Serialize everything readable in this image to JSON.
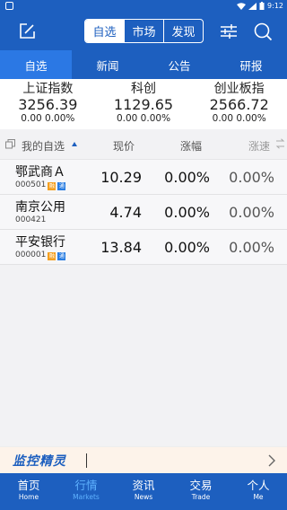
{
  "status_bar": {
    "time": "9:12"
  },
  "header": {
    "segments": [
      "自选",
      "市场",
      "发现"
    ],
    "active_segment": "自选"
  },
  "sub_tabs": [
    "自选",
    "新闻",
    "公告",
    "研报"
  ],
  "indices": [
    {
      "name": "上证指数",
      "value": "3256.39",
      "change": "0.00 0.00%"
    },
    {
      "name": "科创",
      "value": "1129.65",
      "change": "0.00 0.00%"
    },
    {
      "name": "创业板指",
      "value": "2566.72",
      "change": "0.00 0.00%"
    }
  ],
  "list_header": {
    "name": "我的自选",
    "price": "现价",
    "change": "涨幅",
    "speed": "涨速"
  },
  "stocks": [
    {
      "name": "鄂武商Ａ",
      "code": "000501",
      "badges": [
        "融",
        "通"
      ],
      "price": "10.29",
      "change": "0.00%",
      "speed": "0.00%"
    },
    {
      "name": "南京公用",
      "code": "000421",
      "badges": [],
      "price": "4.74",
      "change": "0.00%",
      "speed": "0.00%"
    },
    {
      "name": "平安银行",
      "code": "000001",
      "badges": [
        "融",
        "通"
      ],
      "price": "13.84",
      "change": "0.00%",
      "speed": "0.00%"
    }
  ],
  "monitor": {
    "logo": "监控精灵"
  },
  "bottom_nav": [
    {
      "cn": "首页",
      "en": "Home"
    },
    {
      "cn": "行情",
      "en": "Markets"
    },
    {
      "cn": "资讯",
      "en": "News"
    },
    {
      "cn": "交易",
      "en": "Trade"
    },
    {
      "cn": "个人",
      "en": "Me"
    }
  ],
  "colors": {
    "primary": "#1d5fbf",
    "active_tab": "#2b78e4",
    "nav_active": "#5fb2ff",
    "badge_rong": "#f5a020",
    "badge_tong": "#2a7de1"
  }
}
